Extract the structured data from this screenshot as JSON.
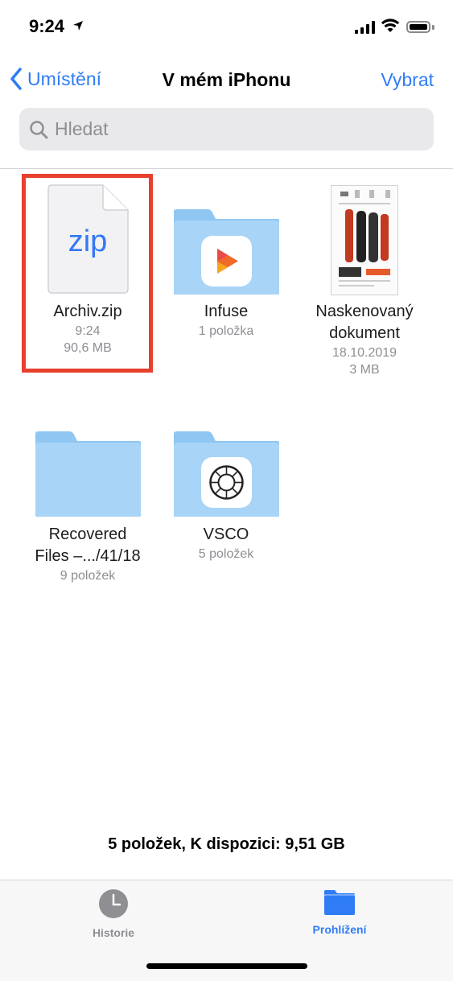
{
  "status": {
    "time": "9:24"
  },
  "nav": {
    "back_label": "Umístění",
    "title": "V mém iPhonu",
    "select_label": "Vybrat"
  },
  "search": {
    "placeholder": "Hledat"
  },
  "items": [
    {
      "name": "Archiv.zip",
      "meta1": "9:24",
      "meta2": "90,6 MB",
      "type": "zip-file",
      "icon_text": "zip",
      "highlighted": true
    },
    {
      "name": "Infuse",
      "meta1": "1 položka",
      "type": "folder",
      "app_icon": "infuse-icon"
    },
    {
      "name_line1": "Naskenovaný",
      "name_line2": "dokument",
      "meta1": "18.10.2019",
      "meta2": "3 MB",
      "type": "scanned-document"
    },
    {
      "name_line1": "Recovered",
      "name_line2": "Files –.../41/18",
      "meta1": "9 položek",
      "type": "folder"
    },
    {
      "name": "VSCO",
      "meta1": "5 položek",
      "type": "folder",
      "app_icon": "vsco-icon"
    }
  ],
  "footer": {
    "summary": "5 položek, K dispozici: 9,51 GB"
  },
  "tabs": [
    {
      "label": "Historie",
      "icon": "clock-icon",
      "active": false
    },
    {
      "label": "Prohlížení",
      "icon": "folder-icon",
      "active": true
    }
  ],
  "colors": {
    "accent": "#2f7cf6",
    "highlight": "#e8402d",
    "folder": "#a8d4f7"
  }
}
